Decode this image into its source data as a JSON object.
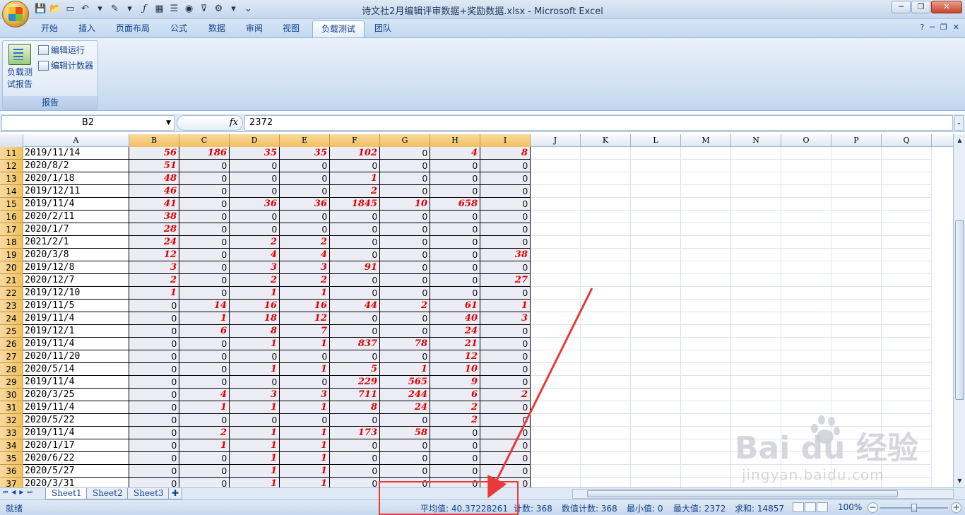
{
  "window": {
    "title": "诗文社2月编辑评审数据+奖励数据.xlsx - Microsoft Excel",
    "controls": [
      "─",
      "❐",
      "✕"
    ]
  },
  "ribbon": {
    "tabs": [
      "开始",
      "插入",
      "页面布局",
      "公式",
      "数据",
      "审阅",
      "视图",
      "负载测试",
      "团队"
    ],
    "active_tab": "负载测试",
    "group": {
      "big_button": "负载测试报告",
      "big_button_line1": "负载测",
      "big_button_line2": "试报告",
      "small_buttons": [
        "编辑运行",
        "编辑计数器"
      ],
      "label": "报告"
    }
  },
  "formula_bar": {
    "name_box": "B2",
    "fx": "fx",
    "value": "2372"
  },
  "columns": [
    "A",
    "B",
    "C",
    "D",
    "E",
    "F",
    "G",
    "H",
    "I",
    "J",
    "K",
    "L",
    "M",
    "N",
    "O",
    "P",
    "Q"
  ],
  "selected_columns": [
    "B",
    "C",
    "D",
    "E",
    "F",
    "G",
    "H",
    "I"
  ],
  "rows": [
    {
      "n": "11",
      "a": "2019/11/14",
      "v": [
        "56",
        "186",
        "35",
        "35",
        "102",
        "0",
        "4",
        "8"
      ]
    },
    {
      "n": "12",
      "a": "2020/8/2",
      "v": [
        "51",
        "0",
        "0",
        "0",
        "0",
        "0",
        "0",
        "0"
      ]
    },
    {
      "n": "13",
      "a": "2020/1/18",
      "v": [
        "48",
        "0",
        "0",
        "0",
        "1",
        "0",
        "0",
        "0"
      ]
    },
    {
      "n": "14",
      "a": "2019/12/11",
      "v": [
        "46",
        "0",
        "0",
        "0",
        "2",
        "0",
        "0",
        "0"
      ]
    },
    {
      "n": "15",
      "a": "2019/11/4",
      "v": [
        "41",
        "0",
        "36",
        "36",
        "1845",
        "10",
        "658",
        "0"
      ]
    },
    {
      "n": "16",
      "a": "2020/2/11",
      "v": [
        "38",
        "0",
        "0",
        "0",
        "0",
        "0",
        "0",
        "0"
      ]
    },
    {
      "n": "17",
      "a": "2020/1/7",
      "v": [
        "28",
        "0",
        "0",
        "0",
        "0",
        "0",
        "0",
        "0"
      ]
    },
    {
      "n": "18",
      "a": "2021/2/1",
      "v": [
        "24",
        "0",
        "2",
        "2",
        "0",
        "0",
        "0",
        "0"
      ]
    },
    {
      "n": "19",
      "a": "2020/3/8",
      "v": [
        "12",
        "0",
        "4",
        "4",
        "0",
        "0",
        "0",
        "38"
      ]
    },
    {
      "n": "20",
      "a": "2019/12/8",
      "v": [
        "3",
        "0",
        "3",
        "3",
        "91",
        "0",
        "0",
        "0"
      ]
    },
    {
      "n": "21",
      "a": "2020/12/7",
      "v": [
        "2",
        "0",
        "2",
        "2",
        "0",
        "0",
        "0",
        "27"
      ]
    },
    {
      "n": "22",
      "a": "2019/12/10",
      "v": [
        "1",
        "0",
        "1",
        "1",
        "0",
        "0",
        "0",
        "0"
      ]
    },
    {
      "n": "23",
      "a": "2019/11/5",
      "v": [
        "0",
        "14",
        "16",
        "16",
        "44",
        "2",
        "61",
        "1"
      ]
    },
    {
      "n": "24",
      "a": "2019/11/4",
      "v": [
        "0",
        "1",
        "18",
        "12",
        "0",
        "0",
        "40",
        "3"
      ]
    },
    {
      "n": "25",
      "a": "2019/12/1",
      "v": [
        "0",
        "6",
        "8",
        "7",
        "0",
        "0",
        "24",
        "0"
      ]
    },
    {
      "n": "26",
      "a": "2019/11/4",
      "v": [
        "0",
        "0",
        "1",
        "1",
        "837",
        "78",
        "21",
        "0"
      ]
    },
    {
      "n": "27",
      "a": "2020/11/20",
      "v": [
        "0",
        "0",
        "0",
        "0",
        "0",
        "0",
        "12",
        "0"
      ]
    },
    {
      "n": "28",
      "a": "2020/5/14",
      "v": [
        "0",
        "0",
        "1",
        "1",
        "5",
        "1",
        "10",
        "0"
      ]
    },
    {
      "n": "29",
      "a": "2019/11/4",
      "v": [
        "0",
        "0",
        "0",
        "0",
        "229",
        "565",
        "9",
        "0"
      ]
    },
    {
      "n": "30",
      "a": "2020/3/25",
      "v": [
        "0",
        "4",
        "3",
        "3",
        "711",
        "244",
        "6",
        "2"
      ]
    },
    {
      "n": "31",
      "a": "2019/11/4",
      "v": [
        "0",
        "1",
        "1",
        "1",
        "8",
        "24",
        "2",
        "0"
      ]
    },
    {
      "n": "32",
      "a": "2020/5/22",
      "v": [
        "0",
        "0",
        "0",
        "0",
        "0",
        "0",
        "2",
        "0"
      ]
    },
    {
      "n": "33",
      "a": "2019/11/4",
      "v": [
        "0",
        "2",
        "1",
        "1",
        "173",
        "58",
        "0",
        "0"
      ]
    },
    {
      "n": "34",
      "a": "2020/1/17",
      "v": [
        "0",
        "1",
        "1",
        "1",
        "0",
        "0",
        "0",
        "0"
      ]
    },
    {
      "n": "35",
      "a": "2020/6/22",
      "v": [
        "0",
        "0",
        "1",
        "1",
        "0",
        "0",
        "0",
        "0"
      ]
    },
    {
      "n": "36",
      "a": "2020/5/27",
      "v": [
        "0",
        "0",
        "1",
        "1",
        "0",
        "0",
        "0",
        "0"
      ]
    },
    {
      "n": "37",
      "a": "2020/3/31",
      "v": [
        "0",
        "0",
        "1",
        "1",
        "0",
        "0",
        "0",
        "0"
      ]
    }
  ],
  "sheet_tabs": [
    "Sheet1",
    "Sheet2",
    "Sheet3"
  ],
  "status": {
    "ready": "就绪",
    "average": "平均值: 40.37228261",
    "count": "计数: 368",
    "numeric_count": "数值计数: 368",
    "min": "最小值: 0",
    "max": "最大值: 2372",
    "sum": "求和: 14857",
    "zoom": "100%",
    "zoom_level_percent": 100
  },
  "watermark": {
    "logo": "Bai du 经验",
    "url": "jingyan.baidu.com"
  },
  "colors": {
    "highlight_text": "#e00000",
    "annotation": "#e83a3a",
    "selected_header": "#f1c15f"
  }
}
